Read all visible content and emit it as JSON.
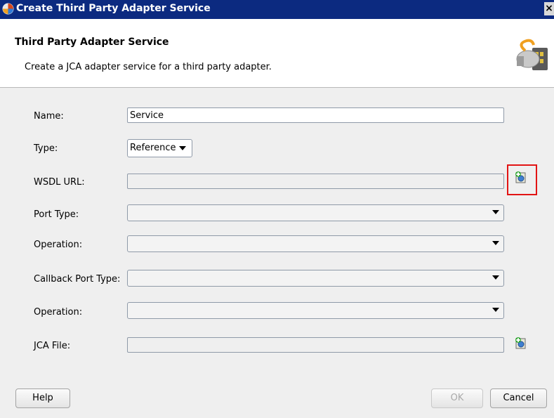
{
  "window": {
    "title": "Create Third Party Adapter Service"
  },
  "header": {
    "title": "Third Party Adapter Service",
    "description": "Create a JCA adapter service for a third party adapter."
  },
  "form": {
    "name": {
      "label": "Name:",
      "value": "Service"
    },
    "type": {
      "label": "Type:",
      "value": "Reference"
    },
    "wsdl_url": {
      "label": "WSDL URL:",
      "value": ""
    },
    "port_type": {
      "label": "Port Type:",
      "value": ""
    },
    "operation": {
      "label": "Operation:",
      "value": ""
    },
    "callback_port_type": {
      "label": "Callback Port Type:",
      "value": ""
    },
    "callback_operation": {
      "label": "Operation:",
      "value": ""
    },
    "jca_file": {
      "label": "JCA File:",
      "value": ""
    }
  },
  "buttons": {
    "help": "Help",
    "ok": "OK",
    "cancel": "Cancel"
  },
  "colors": {
    "titlebar": "#0c2a80",
    "highlight": "#e21414",
    "body": "#efefef"
  }
}
